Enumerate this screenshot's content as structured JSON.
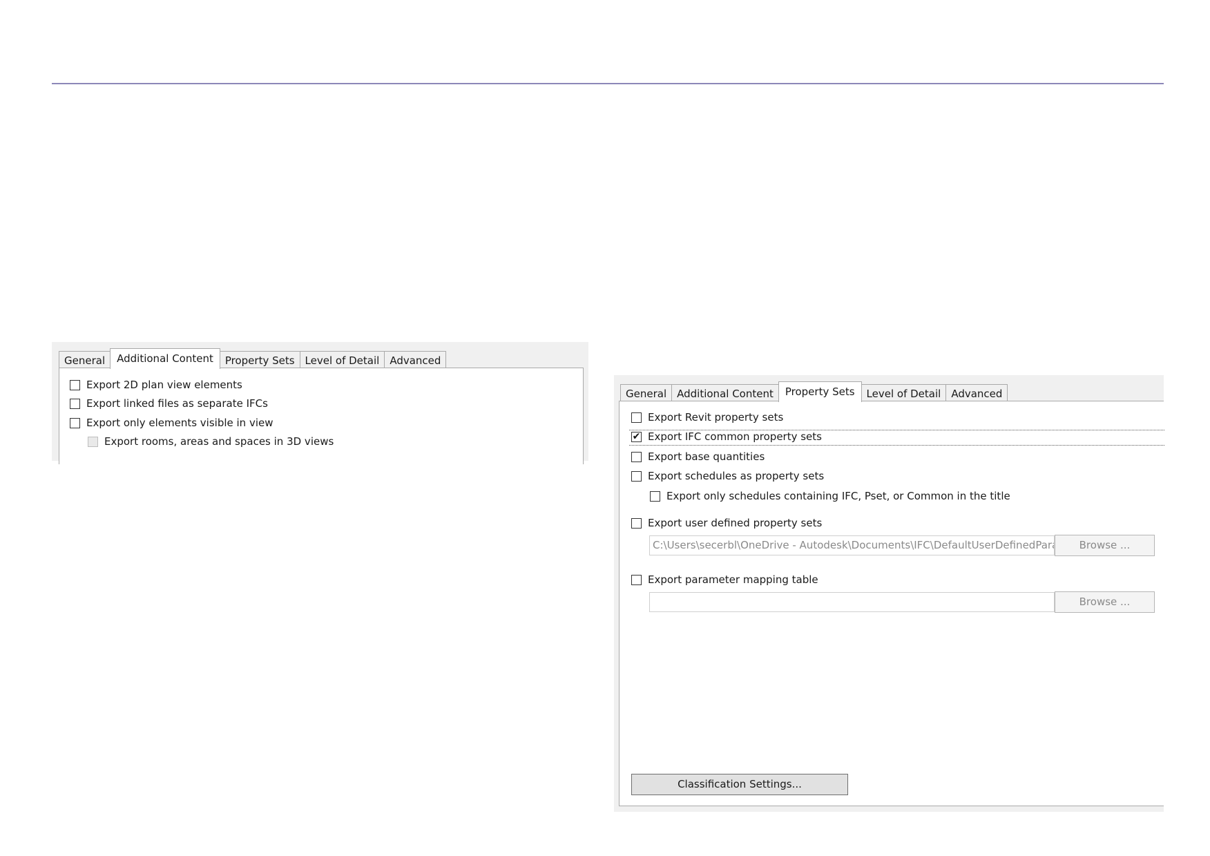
{
  "dialog_left": {
    "tabs": [
      "General",
      "Additional Content",
      "Property Sets",
      "Level of Detail",
      "Advanced"
    ],
    "active_tab": "Additional Content",
    "options": [
      {
        "label": "Export 2D plan view elements",
        "checked": false,
        "enabled": true
      },
      {
        "label": "Export linked files as separate IFCs",
        "checked": false,
        "enabled": true
      },
      {
        "label": "Export only elements visible in view",
        "checked": false,
        "enabled": true
      },
      {
        "label": "Export rooms, areas and spaces in 3D views",
        "checked": false,
        "enabled": false
      }
    ]
  },
  "dialog_right": {
    "tabs": [
      "General",
      "Additional Content",
      "Property Sets",
      "Level of Detail",
      "Advanced"
    ],
    "active_tab": "Property Sets",
    "options": {
      "revit_psets": {
        "label": "Export Revit property sets",
        "checked": false
      },
      "ifc_common": {
        "label": "Export IFC common property sets",
        "checked": true
      },
      "base_quantities": {
        "label": "Export base quantities",
        "checked": false
      },
      "schedules": {
        "label": "Export schedules as property sets",
        "checked": false
      },
      "schedules_only": {
        "label": "Export only schedules containing IFC, Pset, or Common in the title",
        "checked": false
      },
      "user_defined": {
        "label": "Export user defined property sets",
        "checked": false
      },
      "param_mapping": {
        "label": "Export parameter mapping table",
        "checked": false
      }
    },
    "user_defined_path": "C:\\Users\\secerbl\\OneDrive - Autodesk\\Documents\\IFC\\DefaultUserDefinedParam",
    "param_mapping_path": "",
    "browse_label": "Browse ...",
    "classification_button": "Classification Settings..."
  }
}
